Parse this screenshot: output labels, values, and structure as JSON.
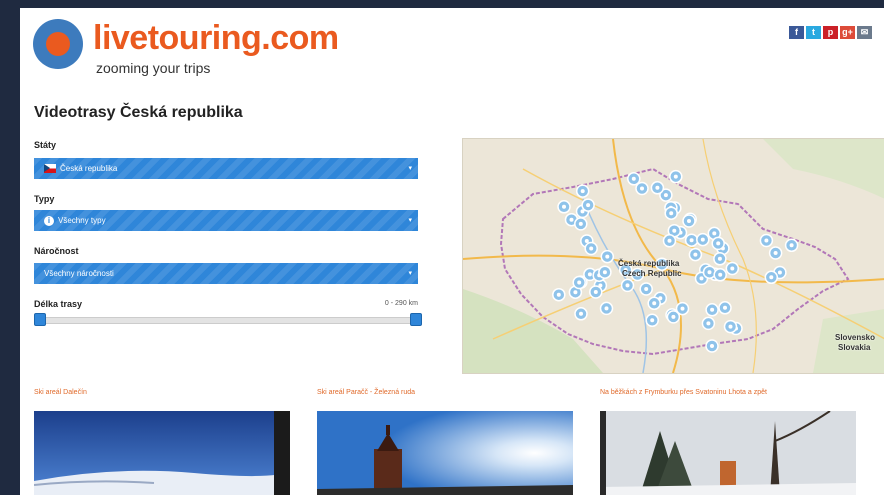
{
  "header": {
    "brand": "livetouring.com",
    "tagline": "zooming your trips",
    "social": [
      {
        "icon": "facebook-icon",
        "glyph": "f",
        "color": "#3b5998"
      },
      {
        "icon": "twitter-icon",
        "glyph": "t",
        "color": "#2aa9e0"
      },
      {
        "icon": "pinterest-icon",
        "glyph": "p",
        "color": "#cb2027"
      },
      {
        "icon": "google-plus-icon",
        "glyph": "g+",
        "color": "#dd4b39"
      },
      {
        "icon": "email-icon",
        "glyph": "✉",
        "color": "#6b7a8c"
      }
    ]
  },
  "page_title": "Videotrasy Česká republika",
  "filters": {
    "states": {
      "label": "Státy",
      "value": "Česká republika",
      "icon": "czech-flag-icon"
    },
    "types": {
      "label": "Typy",
      "value": "Všechny typy",
      "icon": "info-icon"
    },
    "difficulty": {
      "label": "Náročnost",
      "value": "Všechny náročnosti"
    },
    "length": {
      "label": "Délka trasy",
      "value": "0 - 290 km",
      "min_fraction": 0,
      "max_fraction": 1
    }
  },
  "map": {
    "label_cz": "Česká republika",
    "label_en": "Czech Republic",
    "label_sk": "Slovensko",
    "label_sk_en": "Slovakia",
    "marker_count": 68
  },
  "cards": [
    {
      "title": "Ski areál Dalečín"
    },
    {
      "title": "Ski areál Paračč - Železná ruda"
    },
    {
      "title": "Na běžkách z Frymburku přes Svatoninu Lhota a zpět"
    }
  ],
  "colors": {
    "accent": "#2f86d9",
    "brand_orange": "#ea5a1f",
    "brand_blue": "#3d7bbd",
    "card_title": "#e06a2b"
  }
}
